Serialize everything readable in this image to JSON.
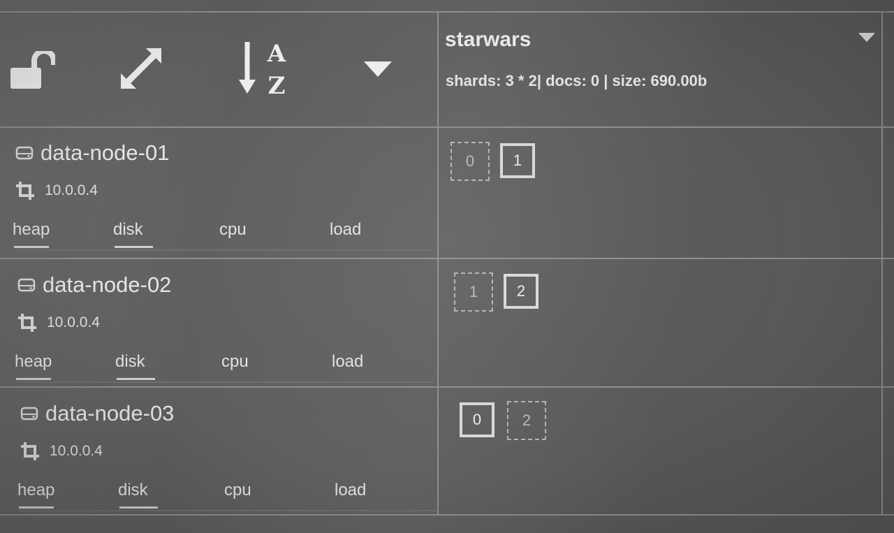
{
  "toolbar": {
    "icons": [
      "unlock-icon",
      "expand-icon",
      "sort-alpha-icon",
      "caret-down-icon"
    ]
  },
  "index": {
    "name": "starwars",
    "stats": "shards: 3 * 2| docs: 0 | size: 690.00b"
  },
  "metric_labels": {
    "heap": "heap",
    "disk": "disk",
    "cpu": "cpu",
    "load": "load"
  },
  "nodes": [
    {
      "name": "data-node-01",
      "ip": "10.0.0.4",
      "heap": 0.5,
      "disk": 0.55
    },
    {
      "name": "data-node-02",
      "ip": "10.0.0.4",
      "heap": 0.5,
      "disk": 0.55
    },
    {
      "name": "data-node-03",
      "ip": "10.0.0.4",
      "heap": 0.5,
      "disk": 0.55
    }
  ],
  "shards": [
    [
      {
        "id": "0",
        "state": "replica"
      },
      {
        "id": "1",
        "state": "primary"
      }
    ],
    [
      {
        "id": "1",
        "state": "replica"
      },
      {
        "id": "2",
        "state": "primary"
      }
    ],
    [
      {
        "id": "0",
        "state": "primary"
      },
      {
        "id": "2",
        "state": "replica"
      }
    ]
  ],
  "colors": {
    "background": "#5f5f5f",
    "grid": "#8e8e8e",
    "text": "#e4e4e4"
  }
}
